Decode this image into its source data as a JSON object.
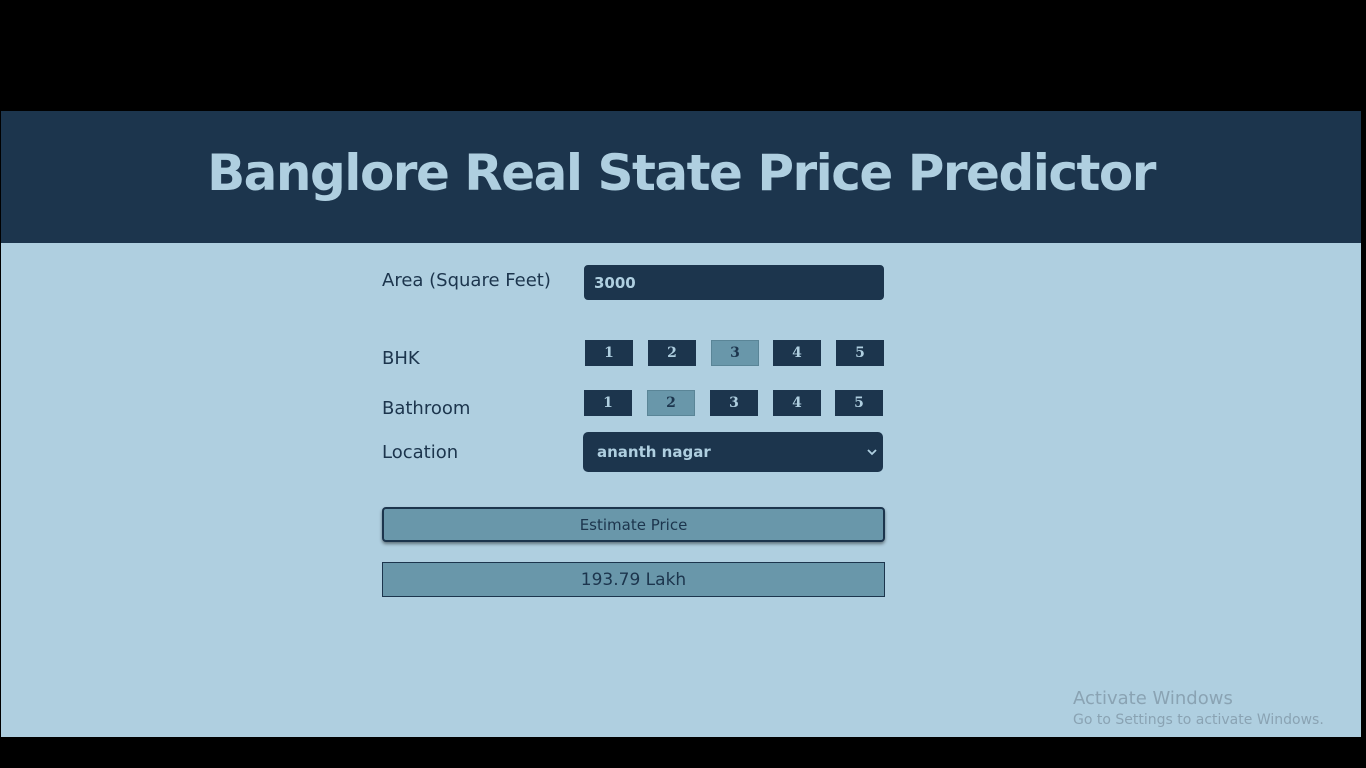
{
  "header": {
    "title": "Banglore Real State Price Predictor"
  },
  "form": {
    "area": {
      "label": "Area (Square Feet)",
      "value": "3000"
    },
    "bhk": {
      "label": "BHK",
      "options": [
        "1",
        "2",
        "3",
        "4",
        "5"
      ],
      "selected": "3"
    },
    "bathroom": {
      "label": "Bathroom",
      "options": [
        "1",
        "2",
        "3",
        "4",
        "5"
      ],
      "selected": "2"
    },
    "location": {
      "label": "Location",
      "value": "ananth nagar",
      "icon": "chevron-down-icon"
    },
    "estimate_button": "Estimate Price",
    "result": "193.79 Lakh"
  },
  "watermark": {
    "line1": "Activate Windows",
    "line2": "Go to Settings to activate Windows."
  },
  "colors": {
    "header_bg": "#1c354d",
    "page_bg": "#afcfe0",
    "selected_bg": "#6997aa"
  }
}
